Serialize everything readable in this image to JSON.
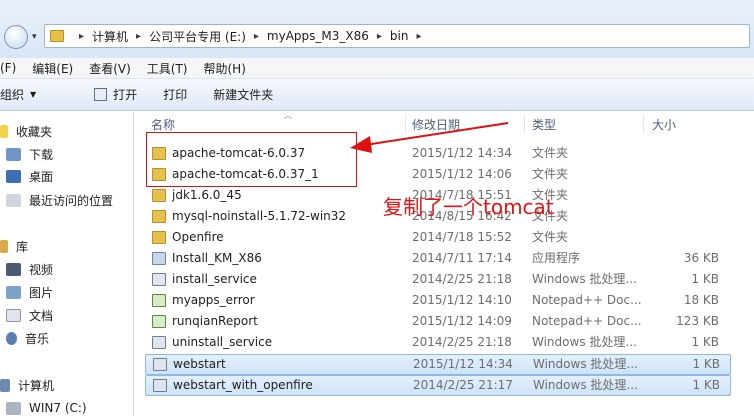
{
  "address_bar": {
    "crumbs": [
      "计算机",
      "公司平台专用 (E:)",
      "myApps_M3_X86",
      "bin"
    ]
  },
  "menubar": [
    "(F)",
    "编辑(E)",
    "查看(V)",
    "工具(T)",
    "帮助(H)"
  ],
  "toolbar": {
    "organize": "组织",
    "open": "打开",
    "print": "打印",
    "new_folder": "新建文件夹"
  },
  "nav": [
    {
      "label": "收藏夹",
      "icon": "star-icon"
    },
    {
      "label": "下载",
      "icon": "download-folder-icon"
    },
    {
      "label": "桌面",
      "icon": "desktop-icon"
    },
    {
      "label": "最近访问的位置",
      "icon": "recent-places-icon"
    },
    {
      "label": "库",
      "icon": "library-icon"
    },
    {
      "label": "视频",
      "icon": "video-icon"
    },
    {
      "label": "图片",
      "icon": "pictures-icon"
    },
    {
      "label": "文档",
      "icon": "documents-icon"
    },
    {
      "label": "音乐",
      "icon": "music-icon"
    },
    {
      "label": "计算机",
      "icon": "computer-icon"
    },
    {
      "label": "WIN7 (C:)",
      "icon": "drive-icon"
    }
  ],
  "columns": {
    "name": "名称",
    "date": "修改日期",
    "type": "类型",
    "size": "大小"
  },
  "files": [
    {
      "name": "apache-tomcat-6.0.37",
      "date": "2015/1/12 14:34",
      "type": "文件夹",
      "size": "",
      "icon": "folder-icon"
    },
    {
      "name": "apache-tomcat-6.0.37_1",
      "date": "2015/1/12 14:06",
      "type": "文件夹",
      "size": "",
      "icon": "folder-icon"
    },
    {
      "name": "jdk1.6.0_45",
      "date": "2014/7/18 15:51",
      "type": "文件夹",
      "size": "",
      "icon": "folder-icon"
    },
    {
      "name": "mysql-noinstall-5.1.72-win32",
      "date": "2014/8/15 16:42",
      "type": "文件夹",
      "size": "",
      "icon": "folder-icon"
    },
    {
      "name": "Openfire",
      "date": "2014/7/18 15:52",
      "type": "文件夹",
      "size": "",
      "icon": "folder-icon"
    },
    {
      "name": "Install_KM_X86",
      "date": "2014/7/11 17:14",
      "type": "应用程序",
      "size": "36 KB",
      "icon": "application-icon"
    },
    {
      "name": "install_service",
      "date": "2014/2/25 21:18",
      "type": "Windows 批处理...",
      "size": "1 KB",
      "icon": "batch-file-icon"
    },
    {
      "name": "myapps_error",
      "date": "2015/1/12 14:10",
      "type": "Notepad++ Doc...",
      "size": "18 KB",
      "icon": "notepad-document-icon"
    },
    {
      "name": "runqianReport",
      "date": "2015/1/12 14:09",
      "type": "Notepad++ Doc...",
      "size": "123 KB",
      "icon": "notepad-document-icon"
    },
    {
      "name": "uninstall_service",
      "date": "2014/2/25 21:18",
      "type": "Windows 批处理...",
      "size": "1 KB",
      "icon": "batch-file-icon"
    },
    {
      "name": "webstart",
      "date": "2015/1/12 14:34",
      "type": "Windows 批处理...",
      "size": "1 KB",
      "icon": "batch-file-icon",
      "selected": true
    },
    {
      "name": "webstart_with_openfire",
      "date": "2014/2/25 21:17",
      "type": "Windows 批处理...",
      "size": "1 KB",
      "icon": "batch-file-icon",
      "selected": true
    }
  ],
  "annotation": {
    "text": "复制了一个tomcat",
    "color": "#e81010"
  }
}
